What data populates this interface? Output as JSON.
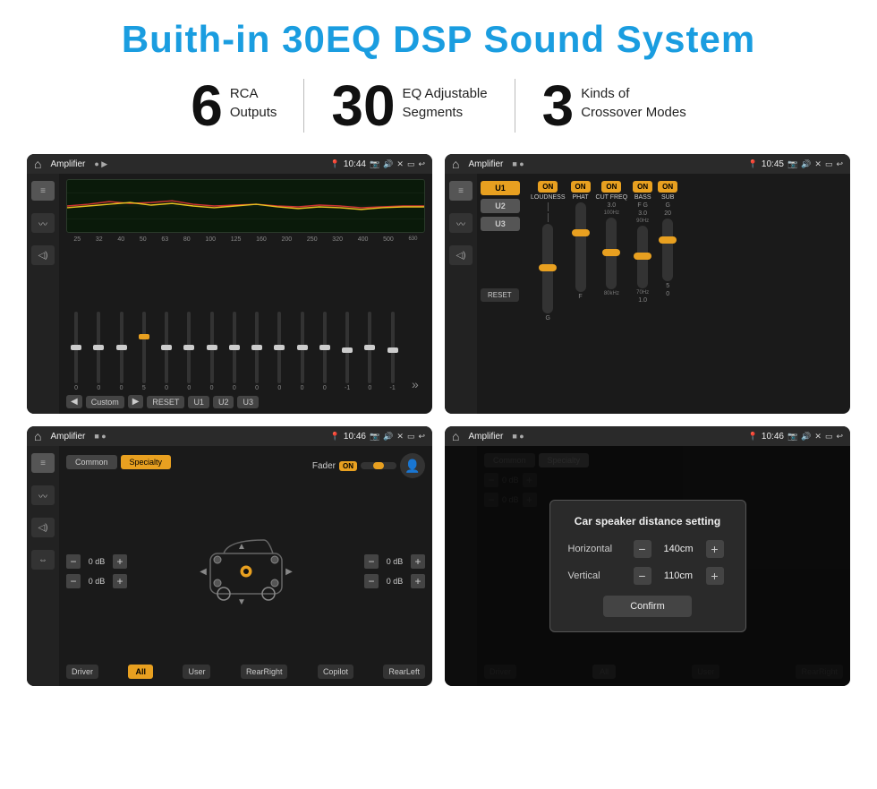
{
  "page": {
    "title": "Buith-in 30EQ DSP Sound System",
    "title_color": "#1a9de0"
  },
  "features": [
    {
      "number": "6",
      "line1": "RCA",
      "line2": "Outputs"
    },
    {
      "number": "30",
      "line1": "EQ Adjustable",
      "line2": "Segments"
    },
    {
      "number": "3",
      "line1": "Kinds of",
      "line2": "Crossover Modes"
    }
  ],
  "screen1": {
    "title": "Amplifier",
    "time": "10:44",
    "freq_labels": [
      "25",
      "32",
      "40",
      "50",
      "63",
      "80",
      "100",
      "125",
      "160",
      "200",
      "250",
      "320",
      "400",
      "500",
      "630"
    ],
    "eq_values": [
      "0",
      "0",
      "0",
      "5",
      "0",
      "0",
      "0",
      "0",
      "0",
      "0",
      "0",
      "0",
      "-1",
      "0",
      "-1"
    ],
    "bottom_buttons": [
      "Custom",
      "RESET",
      "U1",
      "U2",
      "U3"
    ]
  },
  "screen2": {
    "title": "Amplifier",
    "time": "10:45",
    "presets": [
      "U1",
      "U2",
      "U3"
    ],
    "toggles": [
      "LOUDNESS",
      "PHAT",
      "CUT FREQ",
      "BASS",
      "SUB"
    ],
    "reset_label": "RESET"
  },
  "screen3": {
    "title": "Amplifier",
    "time": "10:46",
    "tabs": [
      "Common",
      "Specialty"
    ],
    "fader_label": "Fader",
    "on_label": "ON",
    "db_values": [
      "0 dB",
      "0 dB",
      "0 dB",
      "0 dB"
    ],
    "bottom_buttons": [
      "Driver",
      "All",
      "User",
      "RearRight",
      "Copilot",
      "RearLeft"
    ]
  },
  "screen4": {
    "title": "Amplifier",
    "time": "10:46",
    "tabs": [
      "Common",
      "Specialty"
    ],
    "modal": {
      "title": "Car speaker distance setting",
      "horizontal_label": "Horizontal",
      "horizontal_value": "140cm",
      "vertical_label": "Vertical",
      "vertical_value": "110cm",
      "confirm_label": "Confirm"
    },
    "bottom_buttons": [
      "Driver",
      "All",
      "User",
      "RearRight",
      "Copilot",
      "RearLeft."
    ]
  }
}
